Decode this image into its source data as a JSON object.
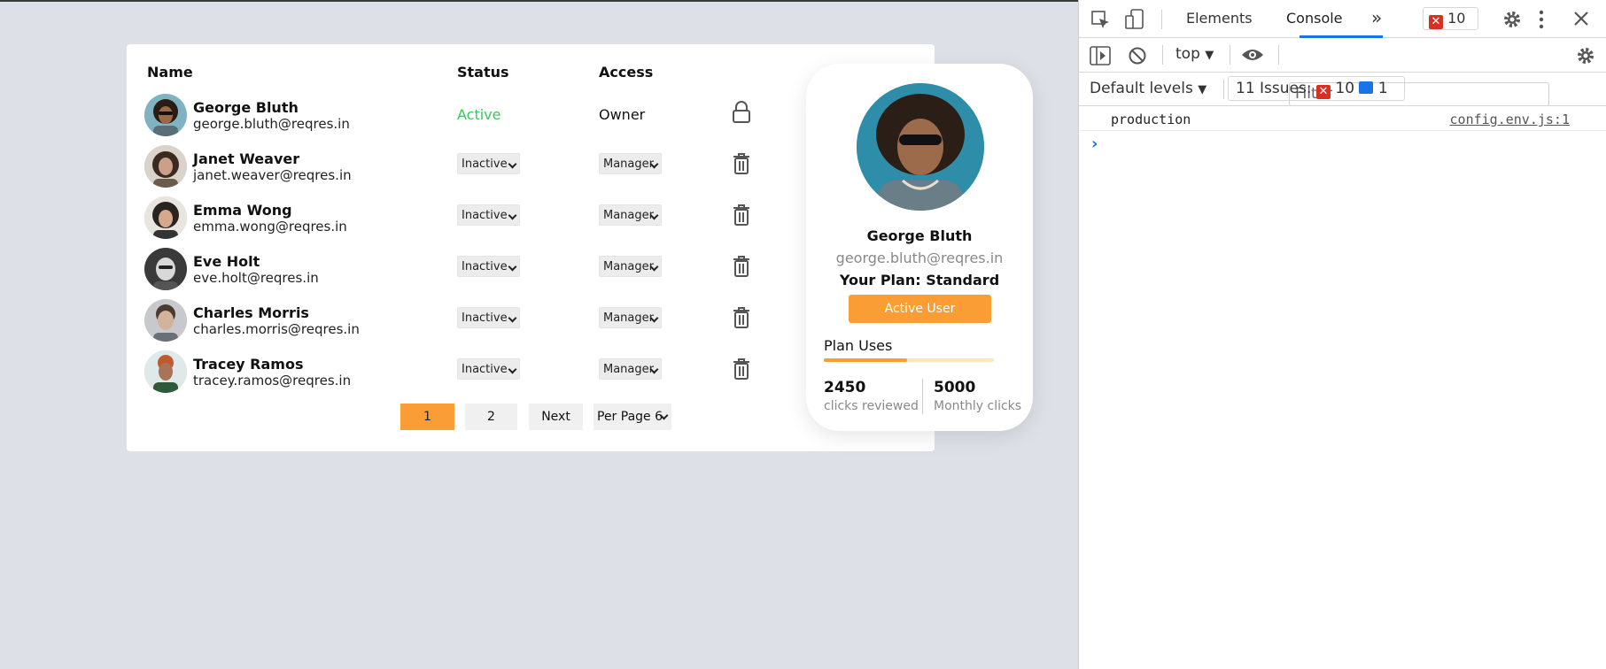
{
  "table": {
    "headers": {
      "name": "Name",
      "status": "Status",
      "access": "Access"
    },
    "rows": [
      {
        "name": "George Bluth",
        "email": "george.bluth@reqres.in",
        "status": "Active",
        "access": "Owner",
        "action_icon": "lock-icon"
      },
      {
        "name": "Janet Weaver",
        "email": "janet.weaver@reqres.in",
        "status": "Inactive",
        "access": "Manager",
        "action_icon": "trash-icon"
      },
      {
        "name": "Emma Wong",
        "email": "emma.wong@reqres.in",
        "status": "Inactive",
        "access": "Manager",
        "action_icon": "trash-icon"
      },
      {
        "name": "Eve Holt",
        "email": "eve.holt@reqres.in",
        "status": "Inactive",
        "access": "Manager",
        "action_icon": "trash-icon"
      },
      {
        "name": "Charles Morris",
        "email": "charles.morris@reqres.in",
        "status": "Inactive",
        "access": "Manager",
        "action_icon": "trash-icon"
      },
      {
        "name": "Tracey Ramos",
        "email": "tracey.ramos@reqres.in",
        "status": "Inactive",
        "access": "Manager",
        "action_icon": "trash-icon"
      }
    ]
  },
  "pagination": {
    "page1": "1",
    "page2": "2",
    "next": "Next",
    "per_page": "Per Page 6",
    "current_page": 1
  },
  "profile": {
    "name": "George Bluth",
    "email": "george.bluth@reqres.in",
    "plan": "Your Plan: Standard",
    "button": "Active User",
    "uses_label": "Plan Uses",
    "usage_fraction": 0.49,
    "reviewed_value": "2450",
    "reviewed_label": "clicks reviewed",
    "monthly_value": "5000",
    "monthly_label": "Monthly clicks"
  },
  "devtools": {
    "tabs": {
      "elements": "Elements",
      "console": "Console"
    },
    "error_count": "10",
    "context": "top",
    "filter_placeholder": "Filter",
    "levels": "Default levels",
    "issues_label": "11 Issues:",
    "issues_errors": "10",
    "issues_info": "1",
    "console_message": "production",
    "console_source": "config.env.js:1",
    "prompt": "›"
  },
  "colors": {
    "accent": "#fb9d35",
    "active_status": "#3bc65a",
    "devtools_blue": "#1a73e8",
    "error_red": "#d93025",
    "background": "#dde0e7"
  }
}
